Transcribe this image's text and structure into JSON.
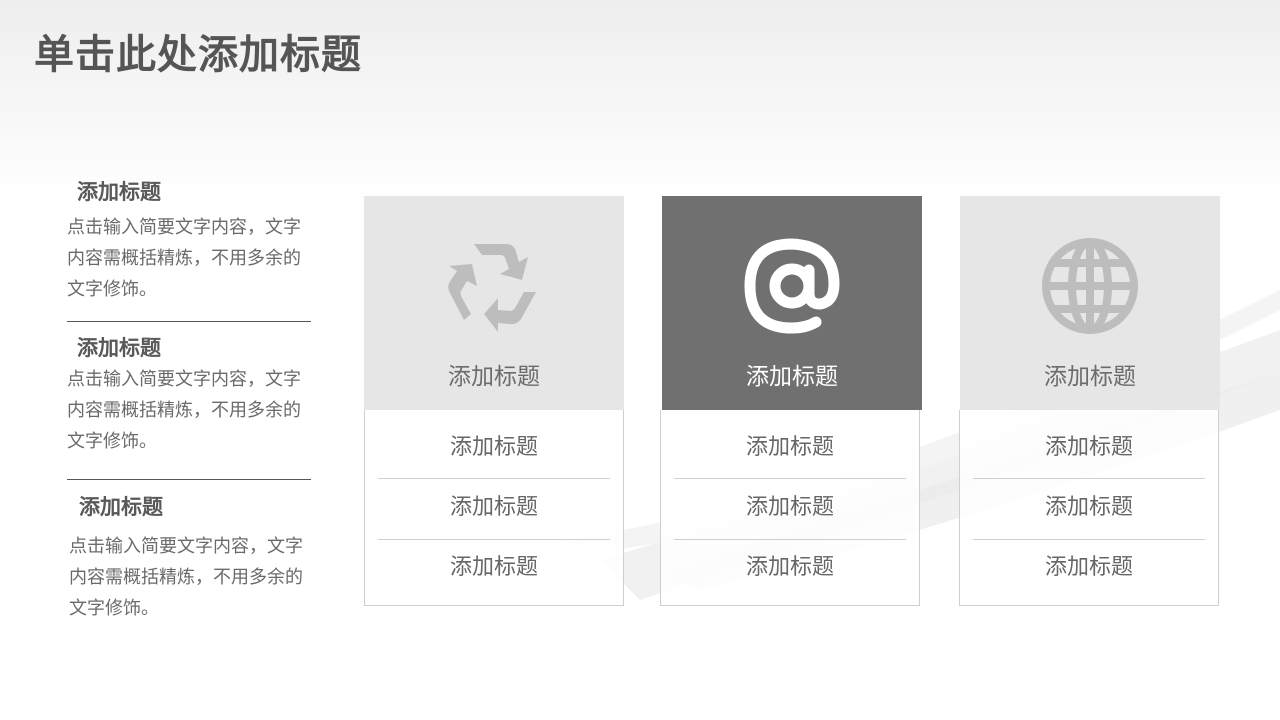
{
  "slide": {
    "title": "单击此处添加标题"
  },
  "left_blocks": [
    {
      "title": "添加标题",
      "text": "点击输入简要文字内容，文字内容需概括精炼，不用多余的文字修饰。"
    },
    {
      "title": "添加标题",
      "text": "点击输入简要文字内容，文字内容需概括精炼，不用多余的文字修饰。"
    },
    {
      "title": "添加标题",
      "text": "点击输入简要文字内容，文字内容需概括精炼，不用多余的文字修饰。"
    }
  ],
  "cards": [
    {
      "icon": "recycle-icon",
      "title": "添加标题",
      "items": [
        "添加标题",
        "添加标题",
        "添加标题"
      ],
      "head_color": "#e6e6e6"
    },
    {
      "icon": "at-sign-icon",
      "title": "添加标题",
      "items": [
        "添加标题",
        "添加标题",
        "添加标题"
      ],
      "head_color": "#707070"
    },
    {
      "icon": "globe-icon",
      "title": "添加标题",
      "items": [
        "添加标题",
        "添加标题",
        "添加标题"
      ],
      "head_color": "#e6e6e6"
    }
  ],
  "colors": {
    "title_text": "#555555",
    "icon_light": "#bdbdbd",
    "icon_dark": "#ffffff"
  }
}
